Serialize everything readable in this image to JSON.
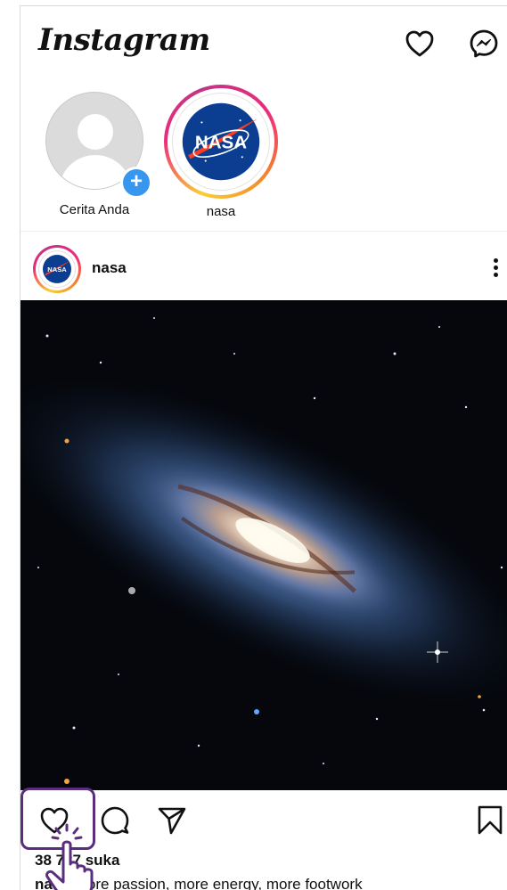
{
  "app": {
    "name": "Instagram"
  },
  "stories": [
    {
      "label": "Cerita Anda",
      "add_badge": "+"
    },
    {
      "label": "nasa",
      "logo_text": "NASA"
    }
  ],
  "post": {
    "username": "nasa",
    "likes_text": "38 787 suka",
    "caption_user": "nasa",
    "caption_text": "More passion, more energy, more footwork"
  },
  "icons": {
    "notifications": "heart-icon",
    "messages": "messenger-icon",
    "like": "heart-outline-icon",
    "comment": "comment-icon",
    "share": "paper-plane-icon",
    "save": "bookmark-icon",
    "more": "more-vertical-icon"
  },
  "colors": {
    "story_ring": "#ee2a7b",
    "add_badge": "#3797ef",
    "tap_highlight": "#5b2d7e"
  }
}
